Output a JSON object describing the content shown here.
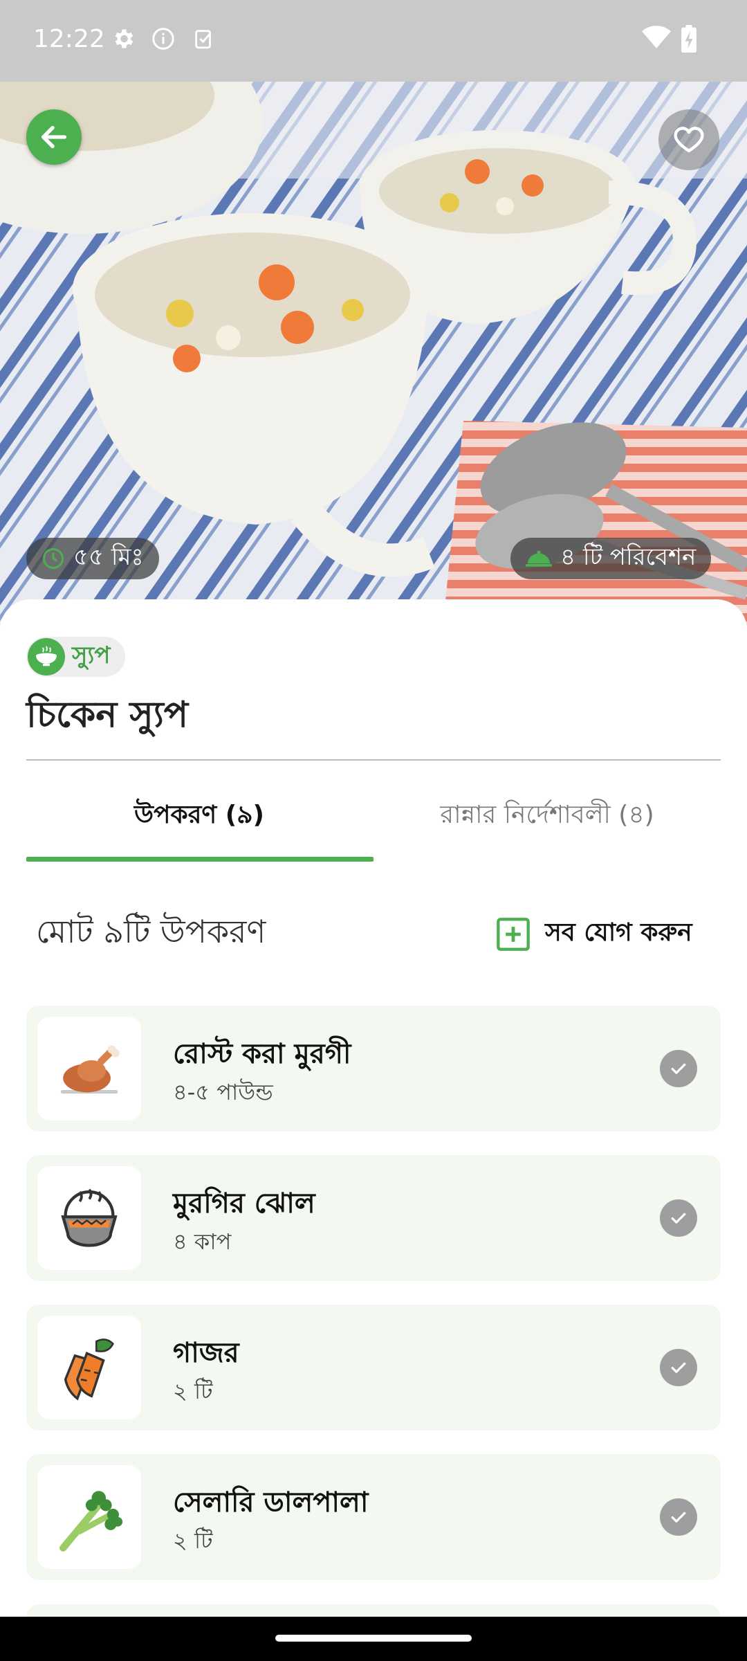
{
  "status_bar": {
    "time": "12:22",
    "icons": [
      "gear-icon",
      "info-icon",
      "clipboard-check-icon",
      "wifi-icon",
      "battery-charging-icon"
    ]
  },
  "hero": {
    "image": "chicken-soup-photo",
    "cook_time": "৫৫ মিঃ",
    "servings": "৪ টি পরিবেশন"
  },
  "recipe": {
    "category": "স্যুপ",
    "title": "চিকেন স্যুপ"
  },
  "tabs": [
    {
      "label": "উপকরণ (৯)",
      "active": true
    },
    {
      "label": "রান্নার নির্দেশাবলী (৪)",
      "active": false
    }
  ],
  "ingredients_header": {
    "total_label": "মোট ৯টি উপকরণ",
    "add_all_label": "সব যোগ করুন"
  },
  "ingredients": [
    {
      "name": "রোস্ট করা মুরগী",
      "qty": "৪-৫ পাউন্ড",
      "icon": "roast-chicken-icon"
    },
    {
      "name": "মুরগির ঝোল",
      "qty": "৪ কাপ",
      "icon": "broth-pot-icon"
    },
    {
      "name": "গাজর",
      "qty": "২ টি",
      "icon": "carrot-icon"
    },
    {
      "name": "সেলারি ডালপালা",
      "qty": "২ টি",
      "icon": "celery-icon"
    }
  ],
  "colors": {
    "accent": "#4caf50",
    "card_bg": "#f3f8f1",
    "status_bar": "#c9c9c9"
  }
}
